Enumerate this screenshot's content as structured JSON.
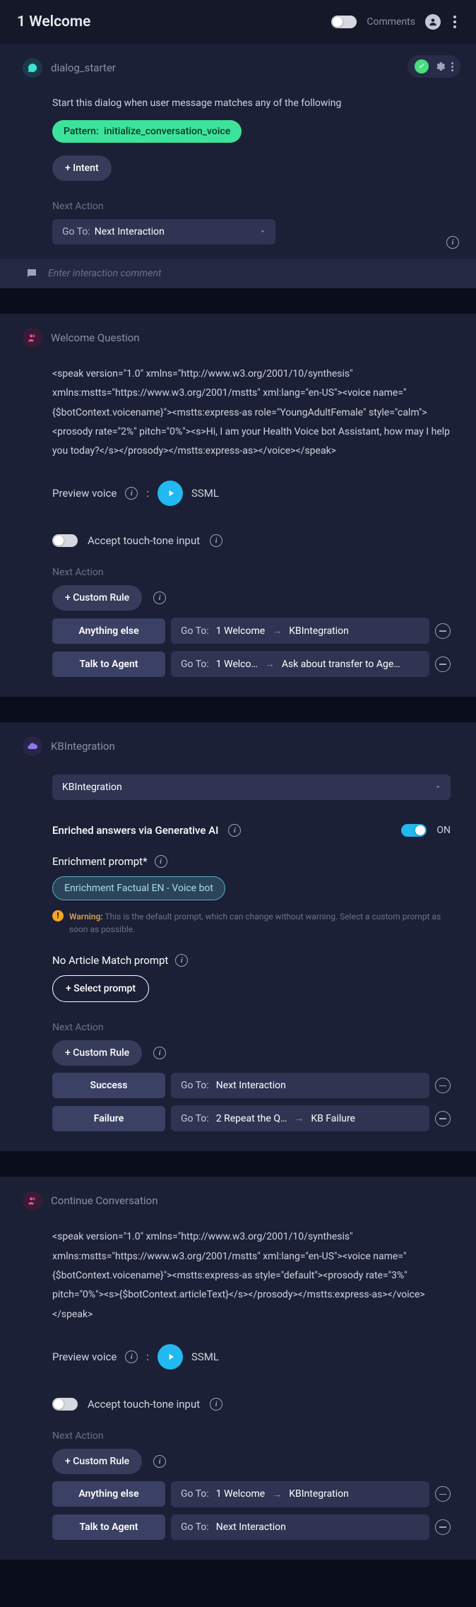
{
  "header": {
    "title": "1 Welcome",
    "comments_label": "Comments"
  },
  "common": {
    "next_action_label": "Next Action",
    "go_to_label": "Go To:",
    "comment_placeholder": "Enter interaction comment",
    "preview_voice_label": "Preview voice",
    "ssml_label": "SSML",
    "touch_tone_label": "Accept touch-tone input",
    "custom_rule_btn": "+ Custom Rule",
    "on_label": "ON"
  },
  "card1": {
    "title": "dialog_starter",
    "desc": "Start this dialog when user message matches any of the following",
    "pattern_prefix": "Pattern:",
    "pattern_value": "initialize_conversation_voice",
    "intent_btn": "+ Intent",
    "next_value": "Next Interaction"
  },
  "card2": {
    "title": "Welcome Question",
    "ssml": "<speak version=\"1.0\" xmlns=\"http://www.w3.org/2001/10/synthesis\" xmlns:mstts=\"https://www.w3.org/2001/mstts\" xml:lang=\"en-US\"><voice name=\"{$botContext.voicename}\"><mstts:express-as role=\"YoungAdultFemale\" style=\"calm\"><prosody rate=\"2%\" pitch=\"0%\"><s>Hi, I am your Health Voice bot Assistant, how may I help you today?</s></prosody></mstts:express-as></voice></speak>",
    "rules": [
      {
        "label": "Anything else",
        "goto": "1 Welcome",
        "then": "KBIntegration"
      },
      {
        "label": "Talk to Agent",
        "goto": "1 Welco…",
        "then": "Ask about transfer to Age…"
      }
    ]
  },
  "card3": {
    "title": "KBIntegration",
    "select_value": "KBIntegration",
    "enriched_label": "Enriched answers via Generative AI",
    "enrichment_prompt_label": "Enrichment prompt*",
    "enrichment_chip": "Enrichment Factual EN - Voice bot",
    "warning_label": "Warning:",
    "warning_text": "This is the default prompt, which can change without warning. Select a custom prompt as soon as possible.",
    "no_match_label": "No Article Match prompt",
    "select_prompt_btn": "+ Select prompt",
    "rules": [
      {
        "label": "Success",
        "goto_combined": "Next Interaction"
      },
      {
        "label": "Failure",
        "goto": "2 Repeat the Q…",
        "then": "KB Failure"
      }
    ]
  },
  "card4": {
    "title": "Continue Conversation",
    "ssml": "<speak version=\"1.0\" xmlns=\"http://www.w3.org/2001/10/synthesis\" xmlns:mstts=\"https://www.w3.org/2001/mstts\" xml:lang=\"en-US\"><voice name=\"{$botContext.voicename}\"><mstts:express-as style=\"default\"><prosody rate=\"3%\" pitch=\"0%\"><s>{$botContext.articleText}</s></prosody></mstts:express-as></voice></speak>",
    "rules": [
      {
        "label": "Anything else",
        "goto": "1 Welcome",
        "then": "KBIntegration"
      },
      {
        "label": "Talk to Agent",
        "goto_combined": "Next Interaction"
      }
    ]
  }
}
